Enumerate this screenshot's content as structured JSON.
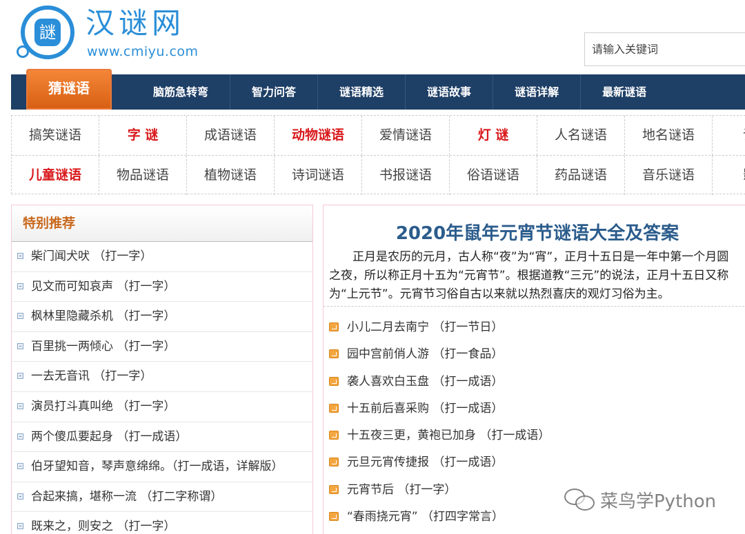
{
  "header": {
    "logo_glyph": "謎",
    "site_name": "汉谜网",
    "site_url": "www.cmiyu.com",
    "search_placeholder": "请输入关键词"
  },
  "nav": {
    "active": "猜谜语",
    "items": [
      "脑筋急转弯",
      "智力问答",
      "谜语精选",
      "谜语故事",
      "谜语详解",
      "最新谜语"
    ]
  },
  "categories": {
    "row1": [
      {
        "label": "搞笑谜语",
        "highlight": false
      },
      {
        "label": "字 谜",
        "highlight": true
      },
      {
        "label": "成语谜语",
        "highlight": false
      },
      {
        "label": "动物谜语",
        "highlight": true
      },
      {
        "label": "爱情谜语",
        "highlight": false
      },
      {
        "label": "灯 谜",
        "highlight": true
      },
      {
        "label": "人名谜语",
        "highlight": false
      },
      {
        "label": "地名谜语",
        "highlight": false
      },
      {
        "label": "词语",
        "highlight": false
      }
    ],
    "row2": [
      {
        "label": "儿童谜语",
        "highlight": true
      },
      {
        "label": "物品谜语",
        "highlight": false
      },
      {
        "label": "植物谜语",
        "highlight": false
      },
      {
        "label": "诗词谜语",
        "highlight": false
      },
      {
        "label": "书报谜语",
        "highlight": false
      },
      {
        "label": "俗语谜语",
        "highlight": false
      },
      {
        "label": "药品谜语",
        "highlight": false
      },
      {
        "label": "音乐谜语",
        "highlight": false
      },
      {
        "label": "影视",
        "highlight": false
      }
    ]
  },
  "featured": {
    "title": "特别推荐",
    "items": [
      "柴门闻犬吠 （打一字）",
      "见文而可知哀声 （打一字）",
      "枫林里隐藏杀机 （打一字）",
      "百里挑一两倾心 （打一字）",
      "一去无音讯 （打一字）",
      "演员打斗真叫绝 （打一字）",
      "两个傻瓜要起身 （打一成语）",
      "伯牙望知音，琴声意绵绵。（打一成语，详解版）",
      "合起来搞，堪称一流 （打二字称谓）",
      "既来之，则安之 （打一字）"
    ]
  },
  "article": {
    "title": "2020年鼠年元宵节谜语大全及答案",
    "intro": "正月是农历的元月，古人称“夜”为“宵”，正月十五日是一年中第一个月圆之夜，所以称正月十五为“元宵节”。根据道教“三元”的说法，正月十五日又称为“上元节”。元宵节习俗自古以来就以热烈喜庆的观灯习俗为主。",
    "riddles": [
      "小儿二月去南宁 （打一节日）",
      "园中宫前俏人游 （打一食品）",
      "袭人喜欢白玉盘 （打一成语）",
      "十五前后喜采购 （打一成语）",
      "十五夜三更，黄袍已加身 （打一成语）",
      "元旦元宵传捷报 （打一成语）",
      "元宵节后 （打一字）",
      "“春雨挠元宵” （打四字常言）"
    ]
  },
  "watermark": "菜鸟学Python",
  "colors": {
    "nav_bg": "#1e3f66",
    "nav_active": "#e8793a",
    "brand_blue": "#2a8ed8",
    "highlight_red": "#d9181b",
    "title_blue": "#2b5c8c",
    "featured_title": "#c8681c"
  }
}
